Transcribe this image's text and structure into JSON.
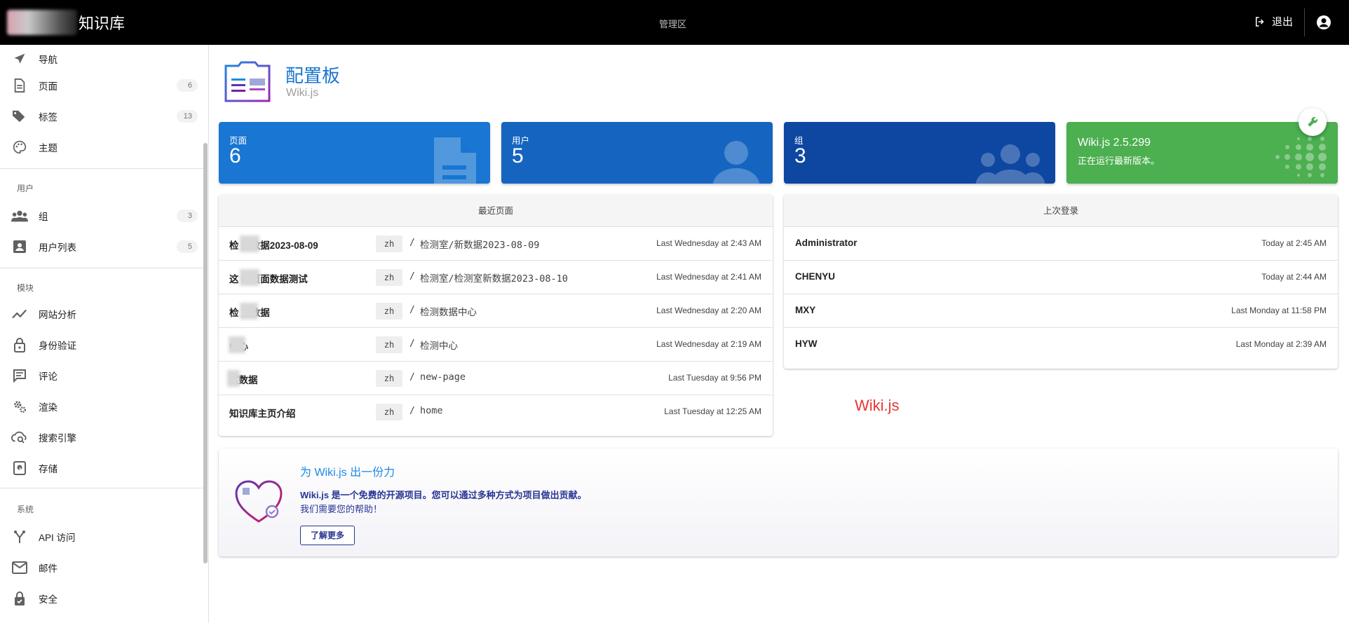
{
  "app": {
    "title": "知识库",
    "center_label": "管理区",
    "logout_label": "退出"
  },
  "sidebar": {
    "items": [
      {
        "label": "导航",
        "icon": "send-icon"
      },
      {
        "label": "页面",
        "icon": "page-icon",
        "count": "6"
      },
      {
        "label": "标签",
        "icon": "tags-icon",
        "count": "13"
      },
      {
        "label": "主题",
        "icon": "palette-icon"
      }
    ],
    "section_users": "用户",
    "users_items": [
      {
        "label": "组",
        "icon": "group-icon",
        "count": "3"
      },
      {
        "label": "用户列表",
        "icon": "account-box-icon",
        "count": "5"
      }
    ],
    "section_modules": "模块",
    "module_items": [
      {
        "label": "网站分析",
        "icon": "chart-line-icon"
      },
      {
        "label": "身份验证",
        "icon": "lock-icon"
      },
      {
        "label": "评论",
        "icon": "comment-icon"
      },
      {
        "label": "渲染",
        "icon": "cogs-icon"
      },
      {
        "label": "搜索引擎",
        "icon": "cloud-search-icon"
      },
      {
        "label": "存储",
        "icon": "storage-icon"
      }
    ],
    "section_system": "系统",
    "system_items": [
      {
        "label": "API 访问",
        "icon": "api-icon"
      },
      {
        "label": "邮件",
        "icon": "email-icon"
      },
      {
        "label": "安全",
        "icon": "security-icon"
      }
    ]
  },
  "header": {
    "title": "配置板",
    "subtitle": "Wiki.js"
  },
  "stats": {
    "pages": {
      "label": "页面",
      "value": "6",
      "color": "#1976d2"
    },
    "users": {
      "label": "用户",
      "value": "5",
      "color": "#1565c0"
    },
    "groups": {
      "label": "组",
      "value": "3",
      "color": "#0d47a1"
    },
    "version": {
      "title": "Wiki.js 2.5.299",
      "subtitle": "正在运行最新版本。",
      "color": "#4caf50"
    }
  },
  "recent_pages": {
    "title": "最近页面",
    "rows": [
      {
        "title": "检 新数据2023-08-09",
        "locale": "zh",
        "path": "检测室/新数据2023-08-09",
        "date": "Last Wednesday at 2:43 AM"
      },
      {
        "title": "这 新页面数据测试",
        "locale": "zh",
        "path": "检测室/检测室新数据2023-08-10",
        "date": "Last Wednesday at 2:41 AM"
      },
      {
        "title": "检 室数据",
        "locale": "zh",
        "path": "检测数据中心",
        "date": "Last Wednesday at 2:20 AM"
      },
      {
        "title": " 中心",
        "locale": "zh",
        "path": "检测中心",
        "date": "Last Wednesday at 2:19 AM"
      },
      {
        "title": " 试数据",
        "locale": "zh",
        "path": "new-page",
        "date": "Last Tuesday at 9:56 PM"
      },
      {
        "title": "知识库主页介绍",
        "locale": "zh",
        "path": "home",
        "date": "Last Tuesday at 12:25 AM"
      }
    ]
  },
  "last_logins": {
    "title": "上次登录",
    "rows": [
      {
        "name": "Administrator",
        "date": "Today at 2:45 AM"
      },
      {
        "name": "CHENYU",
        "date": "Today at 2:44 AM"
      },
      {
        "name": "MXY",
        "date": "Last Monday at 11:58 PM"
      },
      {
        "name": "HYW",
        "date": "Last Monday at 2:39 AM"
      }
    ]
  },
  "annotation": "Wiki.js",
  "contribute": {
    "title": "为 Wiki.js 出一份力",
    "text": "Wiki.js 是一个免费的开源项目。您可以通过多种方式为项目做出贡献。",
    "text2": "我们需要您的帮助！",
    "button": "了解更多"
  }
}
